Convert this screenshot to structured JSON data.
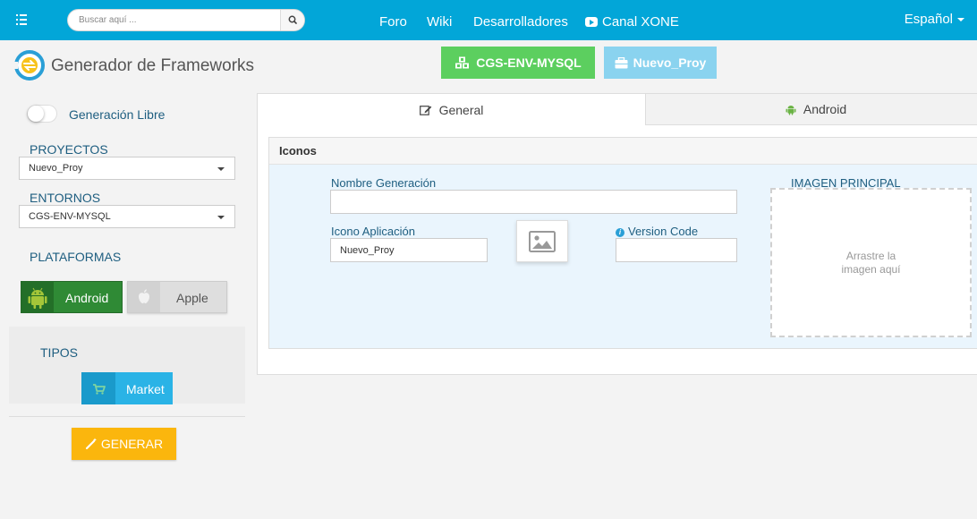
{
  "navbar": {
    "search_placeholder": "Buscar aquí ...",
    "links": [
      "Foro",
      "Wiki",
      "Desarrolladores",
      "Canal XONE"
    ],
    "language": "Español"
  },
  "header": {
    "app_title": "Generador de Frameworks",
    "environment_button": "CGS-ENV-MYSQL",
    "project_button": "Nuevo_Proy"
  },
  "sidebar": {
    "toggle_label": "Generación Libre",
    "proyectos_label": "PROYECTOS",
    "proyectos_value": "Nuevo_Proy",
    "entornos_label": "ENTORNOS",
    "entornos_value": "CGS-ENV-MYSQL",
    "plataformas_label": "PLATAFORMAS",
    "platforms": [
      "Android",
      "Apple"
    ],
    "tipos_label": "TIPOS",
    "tipos_button": "Market",
    "generate_button": "GENERAR"
  },
  "main": {
    "tabs": [
      "General",
      "Android"
    ],
    "panel_title": "Iconos",
    "nombre_generacion_label": "Nombre Generación",
    "nombre_generacion_value": "",
    "icono_aplicacion_label": "Icono Aplicación",
    "icono_aplicacion_value": "Nuevo_Proy",
    "version_code_label": "Version Code",
    "version_code_value": "",
    "imagen_principal_label": "IMAGEN PRINCIPAL",
    "drop_text_line1": "Arrastre la",
    "drop_text_line2": "imagen aquí"
  },
  "colors": {
    "navbar": "#02a6d8",
    "environment_button": "#5ccf5f",
    "project_button": "#8ad3ef",
    "android_button": "#2f8a35",
    "market_button": "#2ab3e6",
    "generate_button": "#fbb60d"
  }
}
